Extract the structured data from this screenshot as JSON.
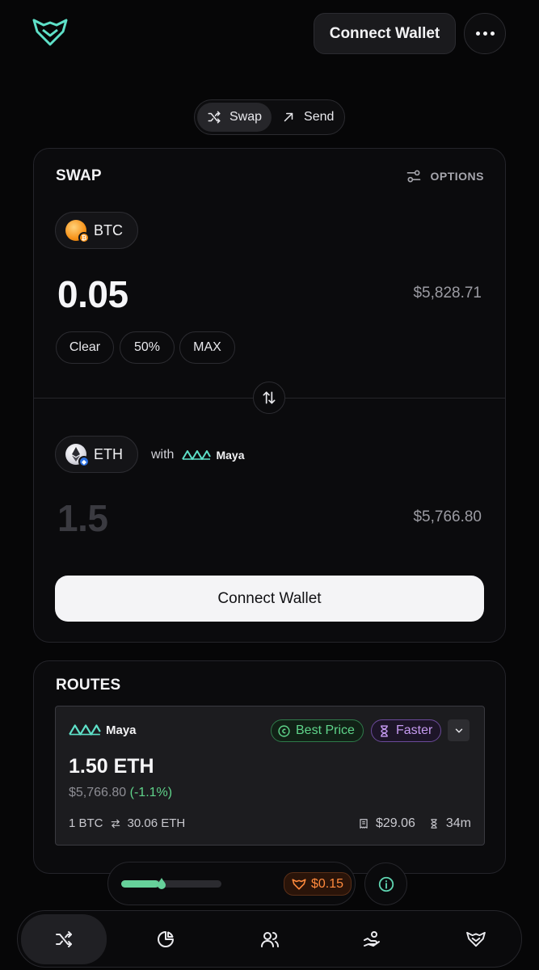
{
  "header": {
    "logo_icon": "fox-logo-icon",
    "connect_wallet_label": "Connect Wallet",
    "more_icon": "more-dots-icon"
  },
  "mode_toggle": {
    "tabs": [
      {
        "label": "Swap",
        "icon": "shuffle-icon",
        "active": true
      },
      {
        "label": "Send",
        "icon": "arrow-up-right-icon",
        "active": false
      }
    ]
  },
  "swap": {
    "title": "SWAP",
    "options_label": "OPTIONS",
    "from": {
      "token": "BTC",
      "amount": "0.05",
      "usd_value": "$5,828.71",
      "quick_amounts": [
        "Clear",
        "50%",
        "MAX"
      ]
    },
    "to": {
      "token": "ETH",
      "amount": "1.5",
      "usd_value": "$5,766.80",
      "with_label": "with",
      "provider": "Maya"
    },
    "connect_wallet_label": "Connect Wallet"
  },
  "routes": {
    "title": "ROUTES",
    "items": [
      {
        "provider": "Maya",
        "badges": {
          "best_price": "Best Price",
          "faster": "Faster"
        },
        "output_amount": "1.50 ETH",
        "output_usd": "$5,766.80",
        "output_change": "(-1.1%)",
        "rate_from": "1 BTC",
        "rate_to": "30.06 ETH",
        "fee": "$29.06",
        "time": "34m"
      }
    ]
  },
  "fee_bar": {
    "slippage_progress": 0.38,
    "fee_label": "$0.15"
  },
  "bottom_nav": {
    "items": [
      {
        "icon": "shuffle-icon",
        "active": true
      },
      {
        "icon": "pie-chart-icon",
        "active": false
      },
      {
        "icon": "users-icon",
        "active": false
      },
      {
        "icon": "hand-coins-icon",
        "active": false
      },
      {
        "icon": "fox-logo-icon",
        "active": false
      }
    ]
  },
  "colors": {
    "background": "#060607",
    "card": "#0b0b0d",
    "accent_green": "#5fd48a",
    "accent_purple": "#c59af0",
    "accent_orange": "#ff8a3d",
    "logo_teal": "#5ee0c8",
    "btc_orange": "#f7931a",
    "eth_blue": "#627eea"
  }
}
